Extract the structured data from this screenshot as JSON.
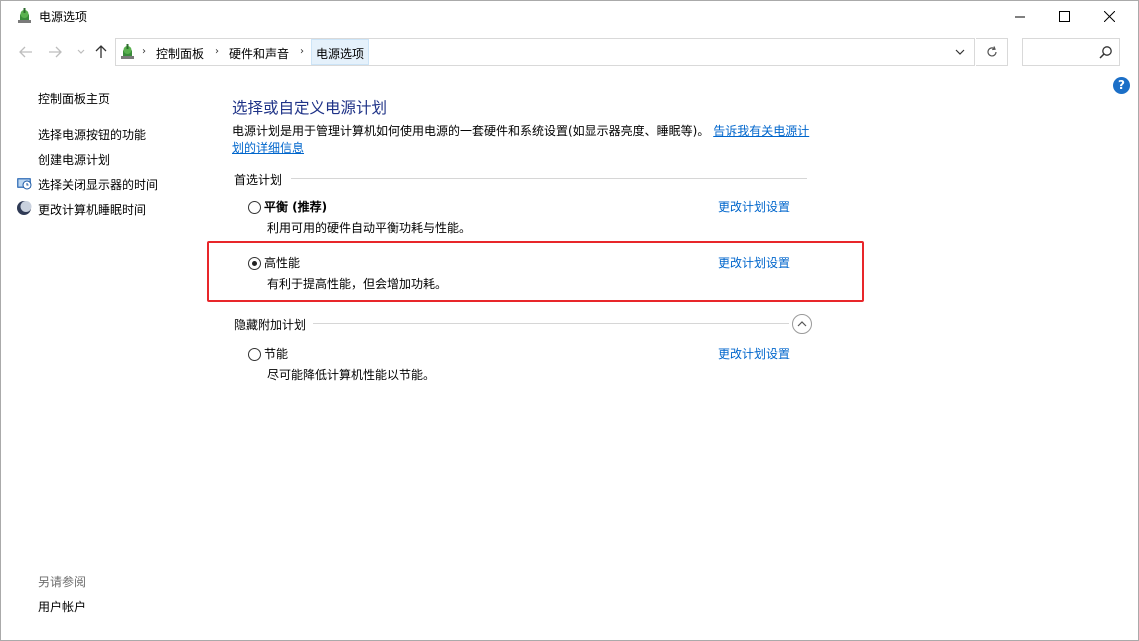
{
  "window": {
    "title": "电源选项",
    "icon": "power-options-icon"
  },
  "address": {
    "breadcrumbs": [
      "控制面板",
      "硬件和声音",
      "电源选项"
    ],
    "search_placeholder": ""
  },
  "sidebar": {
    "home_link": "控制面板主页",
    "links": [
      {
        "label": "选择电源按钮的功能",
        "icon": ""
      },
      {
        "label": "创建电源计划",
        "icon": ""
      },
      {
        "label": "选择关闭显示器的时间",
        "icon": "display-clock-icon"
      },
      {
        "label": "更改计算机睡眠时间",
        "icon": "sleep-moon-icon"
      }
    ],
    "see_also_label": "另请参阅",
    "see_also_links": [
      "用户帐户"
    ]
  },
  "main": {
    "title": "选择或自定义电源计划",
    "description": "电源计划是用于管理计算机如何使用电源的一套硬件和系统设置(如显示器亮度、睡眠等)。",
    "description_link": "告诉我有关电源计划的详细信息",
    "preferred_group_label": "首选计划",
    "hidden_group_label": "隐藏附加计划",
    "plans": [
      {
        "name": "平衡 (推荐)",
        "description": "利用可用的硬件自动平衡功耗与性能。",
        "link": "更改计划设置",
        "selected": false
      },
      {
        "name": "高性能",
        "description": "有利于提高性能，但会增加功耗。",
        "link": "更改计划设置",
        "selected": true
      },
      {
        "name": "节能",
        "description": "尽可能降低计算机性能以节能。",
        "link": "更改计划设置",
        "selected": false
      }
    ]
  },
  "colors": {
    "link": "#0066cc",
    "title": "#1e3287",
    "highlight": "#e8262a"
  }
}
